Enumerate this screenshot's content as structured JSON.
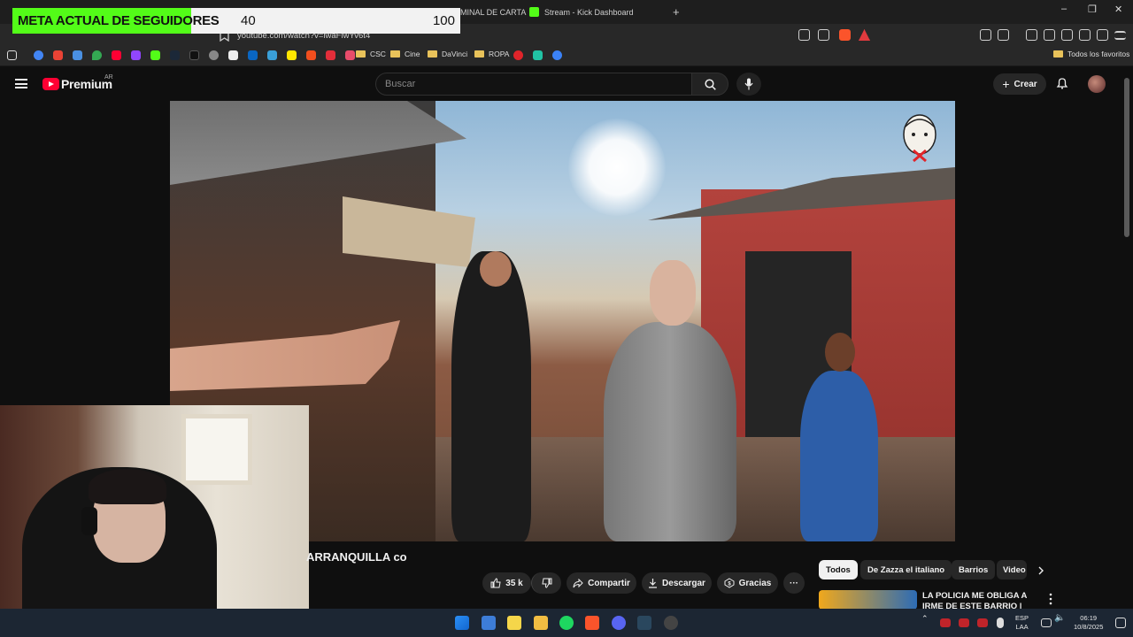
{
  "browser": {
    "tabs": [
      {
        "label": "MINAL DE CARTA"
      },
      {
        "label": "Stream - Kick Dashboard"
      }
    ],
    "new_tab_glyph": "+",
    "window_controls": [
      "–",
      "❐",
      "✕"
    ],
    "url": "youtube.com/watch?v=lwaFlwYv6t4",
    "bookmark_folders": [
      "CSC",
      "Cine",
      "DaVinci",
      "ROPA"
    ],
    "all_bookmarks": "Todos los favoritos"
  },
  "goal": {
    "label": "META ACTUAL DE SEGUIDORES",
    "current": "40",
    "target": "100",
    "progress_fraction": 0.4,
    "color": "#53fc18"
  },
  "youtube": {
    "brand": "Premium",
    "country": "AR",
    "search_placeholder": "Buscar",
    "create_label": "Crear",
    "video_title": "ARRANQUILLA co",
    "actions": {
      "likes": "35 k",
      "share": "Compartir",
      "download": "Descargar",
      "thanks": "Gracias",
      "more": "···"
    },
    "chips": [
      "Todos",
      "De Zazza el italiano",
      "Barrios",
      "Video"
    ],
    "recommendation": {
      "title": "LA POLICIA ME OBLIGA A IRME DE ESTE BARRIO | Cartagena -"
    }
  },
  "taskbar": {
    "language": [
      "ESP",
      "LAA"
    ],
    "time": "06:19",
    "date": "10/8/2025"
  },
  "colors": {
    "yt_red": "#ff0033",
    "kick_green": "#53fc18",
    "bg": "#0f0f0f"
  }
}
